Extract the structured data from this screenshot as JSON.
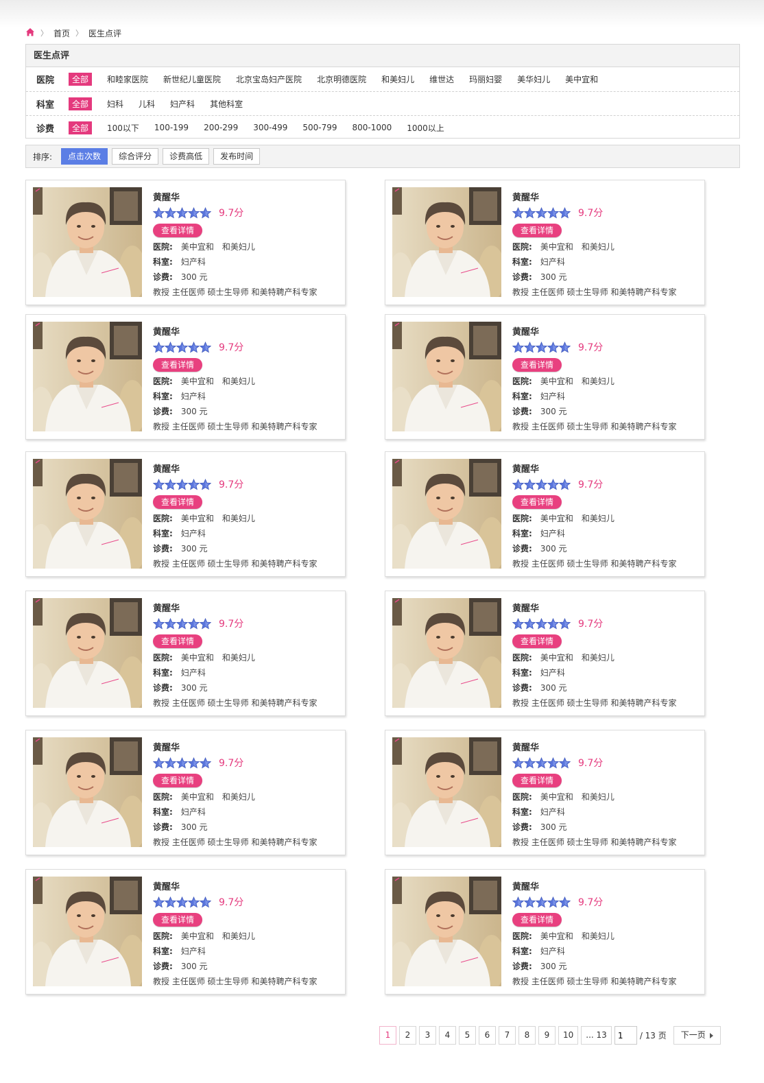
{
  "colors": {
    "accent": "#e4397d",
    "sort_active": "#5b7ee5",
    "star": "#5a75dc"
  },
  "breadcrumb": {
    "home_icon": "home-icon",
    "items": [
      "首页",
      "医生点评"
    ]
  },
  "filters": {
    "title": "医生点评",
    "rows": [
      {
        "label": "医院",
        "options": [
          "全部",
          "和睦家医院",
          "新世纪儿童医院",
          "北京宝岛妇产医院",
          "北京明德医院",
          "和美妇儿",
          "维世达",
          "玛丽妇婴",
          "美华妇儿",
          "美中宜和"
        ],
        "active": 0
      },
      {
        "label": "科室",
        "options": [
          "全部",
          "妇科",
          "儿科",
          "妇产科",
          "其他科室"
        ],
        "active": 0
      },
      {
        "label": "诊费",
        "options": [
          "全部",
          "100以下",
          "100-199",
          "200-299",
          "300-499",
          "500-799",
          "800-1000",
          "1000以上"
        ],
        "active": 0
      }
    ]
  },
  "sort": {
    "label": "排序:",
    "options": [
      "点击次数",
      "综合评分",
      "诊费高低",
      "发布时间"
    ],
    "active": 0
  },
  "doctors": [
    {
      "name": "黄醒华",
      "stars": 5,
      "score": "9.7分",
      "detail": "查看详情",
      "hospital_label": "医院:",
      "hospitals": [
        "美中宜和",
        "和美妇儿"
      ],
      "dept_label": "科室:",
      "dept": "妇产科",
      "fee_label": "诊费:",
      "fee": "300 元",
      "titles": "教授 主任医师 硕士生导师 和美特聘产科专家"
    },
    {
      "name": "黄醒华",
      "stars": 5,
      "score": "9.7分",
      "detail": "查看详情",
      "hospital_label": "医院:",
      "hospitals": [
        "美中宜和",
        "和美妇儿"
      ],
      "dept_label": "科室:",
      "dept": "妇产科",
      "fee_label": "诊费:",
      "fee": "300 元",
      "titles": "教授 主任医师 硕士生导师 和美特聘产科专家"
    },
    {
      "name": "黄醒华",
      "stars": 5,
      "score": "9.7分",
      "detail": "查看详情",
      "hospital_label": "医院:",
      "hospitals": [
        "美中宜和",
        "和美妇儿"
      ],
      "dept_label": "科室:",
      "dept": "妇产科",
      "fee_label": "诊费:",
      "fee": "300 元",
      "titles": "教授 主任医师 硕士生导师 和美特聘产科专家"
    },
    {
      "name": "黄醒华",
      "stars": 5,
      "score": "9.7分",
      "detail": "查看详情",
      "hospital_label": "医院:",
      "hospitals": [
        "美中宜和",
        "和美妇儿"
      ],
      "dept_label": "科室:",
      "dept": "妇产科",
      "fee_label": "诊费:",
      "fee": "300 元",
      "titles": "教授 主任医师 硕士生导师 和美特聘产科专家"
    },
    {
      "name": "黄醒华",
      "stars": 5,
      "score": "9.7分",
      "detail": "查看详情",
      "hospital_label": "医院:",
      "hospitals": [
        "美中宜和",
        "和美妇儿"
      ],
      "dept_label": "科室:",
      "dept": "妇产科",
      "fee_label": "诊费:",
      "fee": "300 元",
      "titles": "教授 主任医师 硕士生导师 和美特聘产科专家"
    },
    {
      "name": "黄醒华",
      "stars": 5,
      "score": "9.7分",
      "detail": "查看详情",
      "hospital_label": "医院:",
      "hospitals": [
        "美中宜和",
        "和美妇儿"
      ],
      "dept_label": "科室:",
      "dept": "妇产科",
      "fee_label": "诊费:",
      "fee": "300 元",
      "titles": "教授 主任医师 硕士生导师 和美特聘产科专家"
    },
    {
      "name": "黄醒华",
      "stars": 5,
      "score": "9.7分",
      "detail": "查看详情",
      "hospital_label": "医院:",
      "hospitals": [
        "美中宜和",
        "和美妇儿"
      ],
      "dept_label": "科室:",
      "dept": "妇产科",
      "fee_label": "诊费:",
      "fee": "300 元",
      "titles": "教授 主任医师 硕士生导师 和美特聘产科专家"
    },
    {
      "name": "黄醒华",
      "stars": 5,
      "score": "9.7分",
      "detail": "查看详情",
      "hospital_label": "医院:",
      "hospitals": [
        "美中宜和",
        "和美妇儿"
      ],
      "dept_label": "科室:",
      "dept": "妇产科",
      "fee_label": "诊费:",
      "fee": "300 元",
      "titles": "教授 主任医师 硕士生导师 和美特聘产科专家"
    },
    {
      "name": "黄醒华",
      "stars": 5,
      "score": "9.7分",
      "detail": "查看详情",
      "hospital_label": "医院:",
      "hospitals": [
        "美中宜和",
        "和美妇儿"
      ],
      "dept_label": "科室:",
      "dept": "妇产科",
      "fee_label": "诊费:",
      "fee": "300 元",
      "titles": "教授 主任医师 硕士生导师 和美特聘产科专家"
    },
    {
      "name": "黄醒华",
      "stars": 5,
      "score": "9.7分",
      "detail": "查看详情",
      "hospital_label": "医院:",
      "hospitals": [
        "美中宜和",
        "和美妇儿"
      ],
      "dept_label": "科室:",
      "dept": "妇产科",
      "fee_label": "诊费:",
      "fee": "300 元",
      "titles": "教授 主任医师 硕士生导师 和美特聘产科专家"
    },
    {
      "name": "黄醒华",
      "stars": 5,
      "score": "9.7分",
      "detail": "查看详情",
      "hospital_label": "医院:",
      "hospitals": [
        "美中宜和",
        "和美妇儿"
      ],
      "dept_label": "科室:",
      "dept": "妇产科",
      "fee_label": "诊费:",
      "fee": "300 元",
      "titles": "教授 主任医师 硕士生导师 和美特聘产科专家"
    },
    {
      "name": "黄醒华",
      "stars": 5,
      "score": "9.7分",
      "detail": "查看详情",
      "hospital_label": "医院:",
      "hospitals": [
        "美中宜和",
        "和美妇儿"
      ],
      "dept_label": "科室:",
      "dept": "妇产科",
      "fee_label": "诊费:",
      "fee": "300 元",
      "titles": "教授 主任医师 硕士生导师 和美特聘产科专家"
    }
  ],
  "pagination": {
    "pages": [
      "1",
      "2",
      "3",
      "4",
      "5",
      "6",
      "7",
      "8",
      "9",
      "10",
      "... 13"
    ],
    "current": 0,
    "input_value": "1",
    "total": "/ 13 页",
    "next": "下一页",
    "next_icon": "triangle-right-icon"
  }
}
